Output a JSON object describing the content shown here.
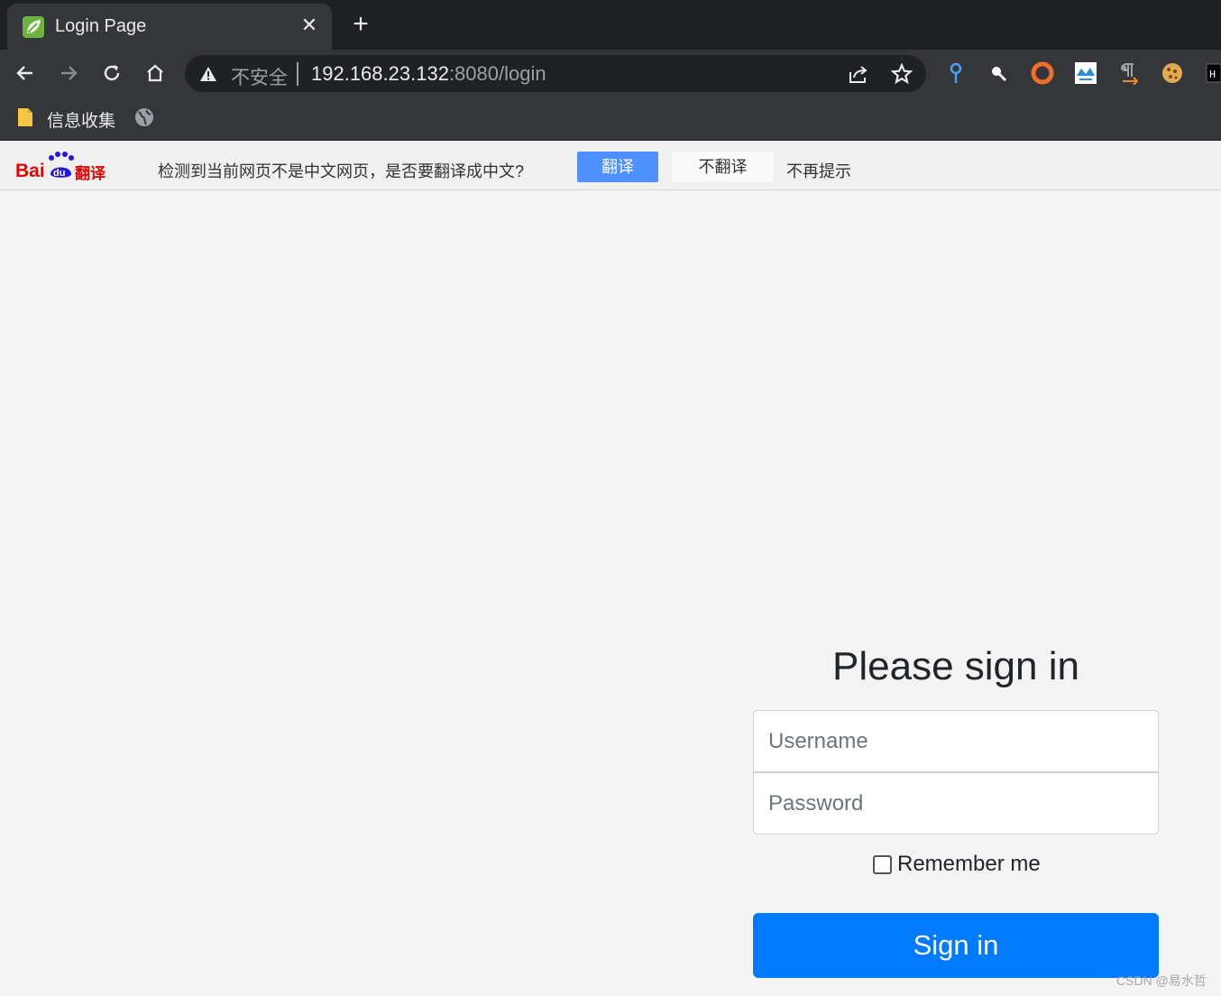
{
  "browser": {
    "tab": {
      "title": "Login Page",
      "close": "✕"
    },
    "new_tab": "+",
    "address": {
      "security_label": "不安全",
      "host": "192.168.23.132",
      "rest": ":8080/login"
    },
    "bookmarks": [
      {
        "label": "信息收集"
      }
    ],
    "extensions": [
      "map-pin-extension",
      "search-extension",
      "circle-extension",
      "cloud-extension",
      "translate-extension",
      "cookie-extension",
      "hackbar-extension"
    ]
  },
  "translate_bar": {
    "logo_brand": "Baidu",
    "logo_suffix": "翻译",
    "message": "检测到当前网页不是中文网页，是否要翻译成中文?",
    "translate_label": "翻译",
    "no_translate_label": "不翻译",
    "never_label": "不再提示"
  },
  "login": {
    "title": "Please sign in",
    "username_placeholder": "Username",
    "password_placeholder": "Password",
    "remember_label": "Remember me",
    "remember_checked": false,
    "signin_label": "Sign in"
  },
  "watermark": "CSDN @易水哲",
  "colors": {
    "primary": "#007bff",
    "translate_blue": "#4d90fe",
    "chrome_dark": "#35363a"
  }
}
